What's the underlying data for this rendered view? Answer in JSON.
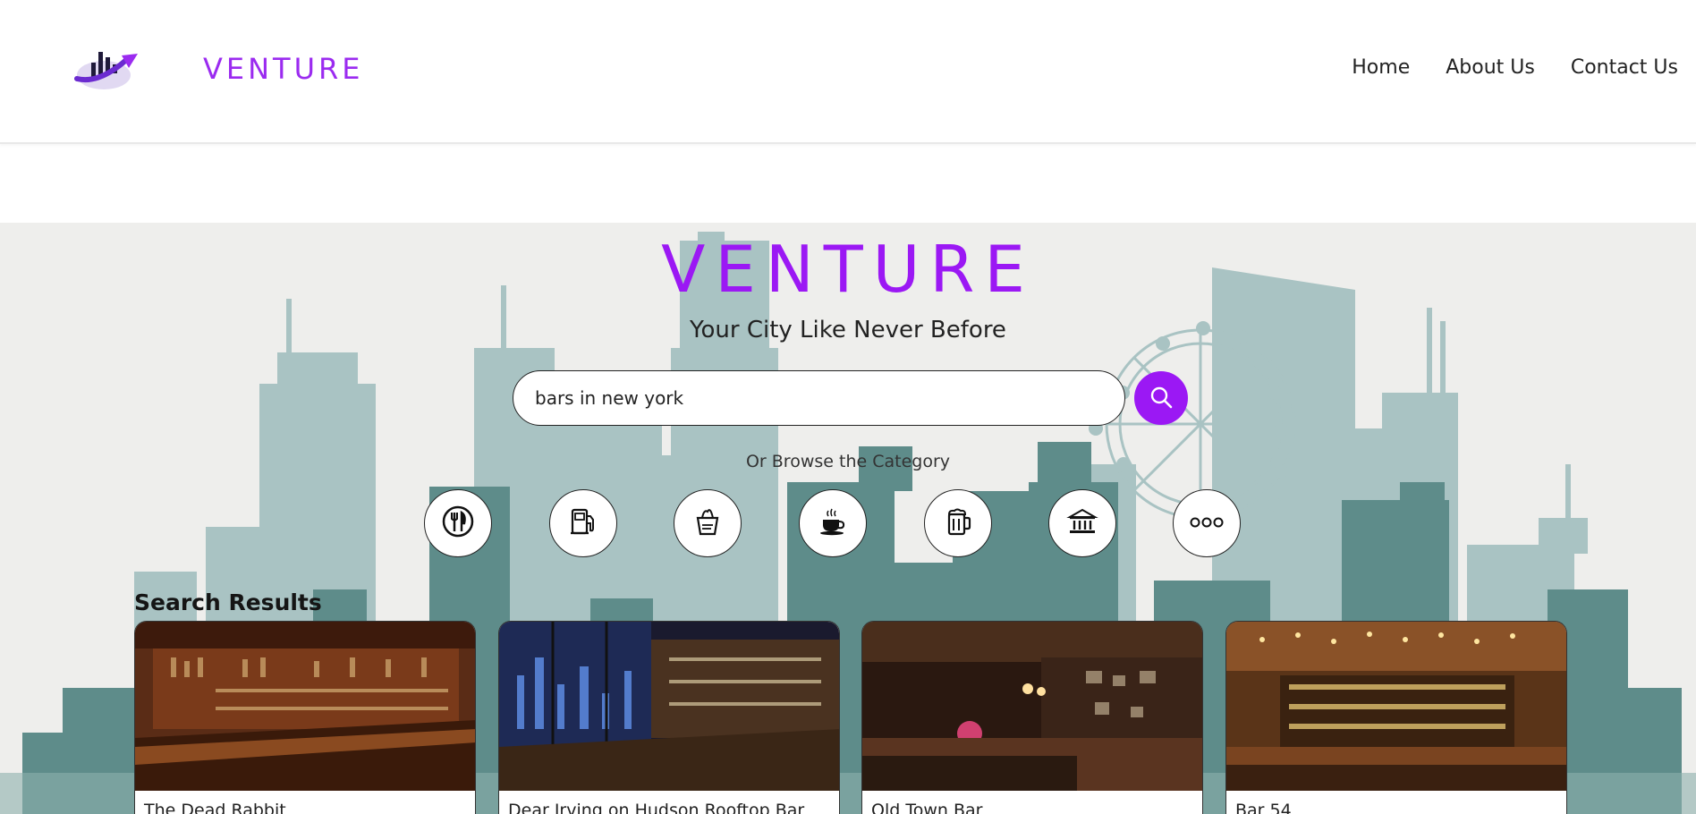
{
  "header": {
    "brand": "VENTURE",
    "nav": [
      "Home",
      "About Us",
      "Contact Us"
    ]
  },
  "hero": {
    "title": "VENTURE",
    "tagline": "Your City Like Never Before",
    "search": {
      "value": "bars in new york",
      "placeholder": ""
    },
    "browse_label": "Or Browse the Category",
    "categories": [
      "restaurant-icon",
      "gas-station-icon",
      "grocery-icon",
      "cafe-icon",
      "bar-icon",
      "museum-icon",
      "more-icon"
    ]
  },
  "results": {
    "title": "Search Results",
    "cards": [
      {
        "name": "The Dead Rabbit"
      },
      {
        "name": "Dear Irving on Hudson Rooftop Bar"
      },
      {
        "name": "Old Town Bar"
      },
      {
        "name": "Bar 54"
      }
    ]
  },
  "colors": {
    "brand": "#9b18f4",
    "skyline_light": "#a5c0c0",
    "skyline_dark": "#5f8d8b"
  }
}
